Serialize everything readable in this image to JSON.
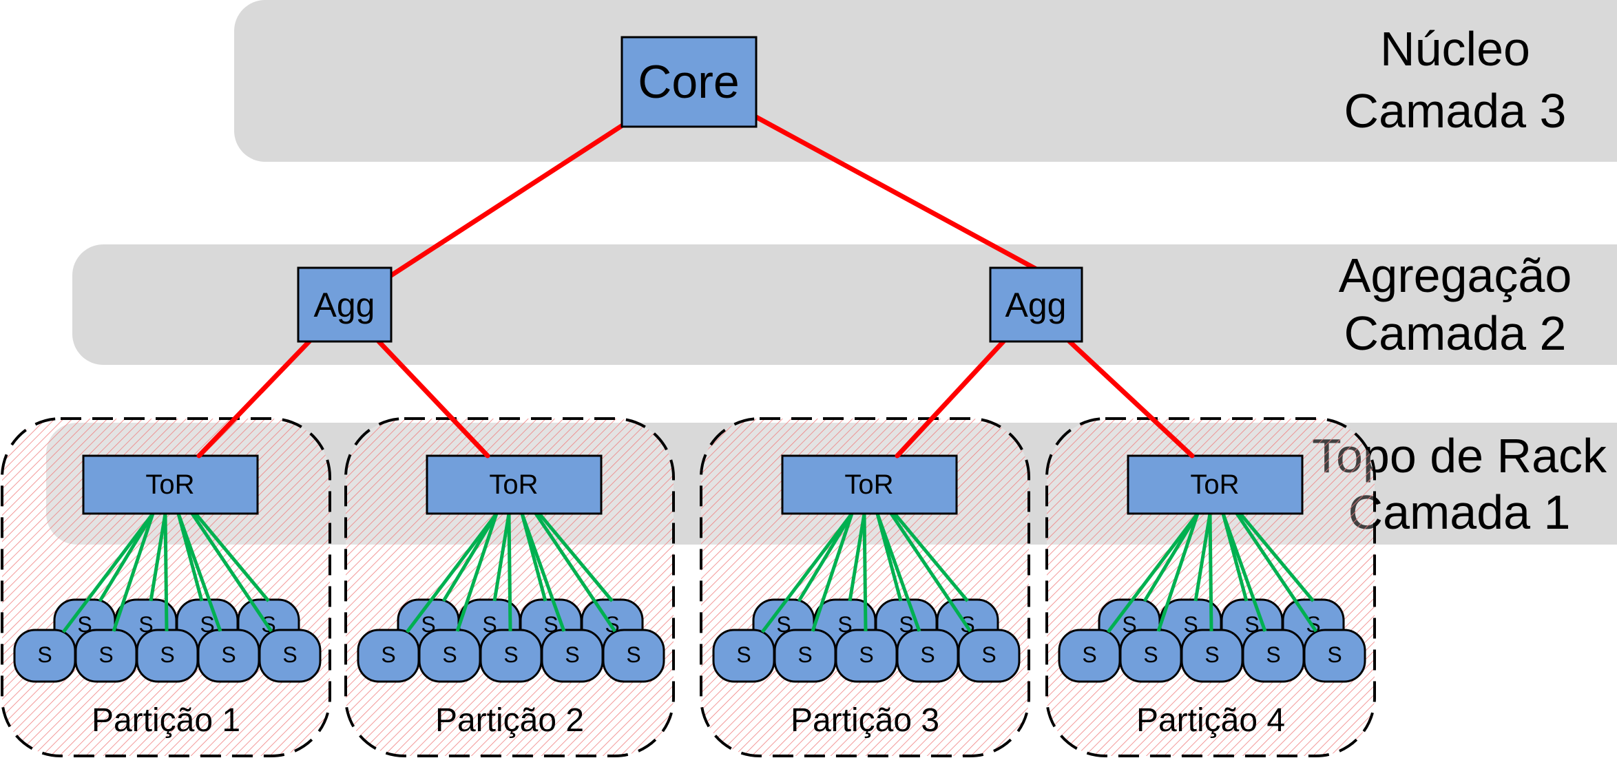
{
  "layers": [
    {
      "line1": "Núcleo",
      "line2": "Camada 3"
    },
    {
      "line1": "Agregação",
      "line2": "Camada 2"
    },
    {
      "line1": "Topo de Rack",
      "line2": "Camada 1"
    }
  ],
  "core": {
    "label": "Core"
  },
  "aggregation": [
    {
      "label": "Agg"
    },
    {
      "label": "Agg"
    }
  ],
  "partitions": [
    {
      "label": "Partição 1",
      "tor": "ToR",
      "server_label": "S",
      "servers": 9
    },
    {
      "label": "Partição 2",
      "tor": "ToR",
      "server_label": "S",
      "servers": 9
    },
    {
      "label": "Partição 3",
      "tor": "ToR",
      "server_label": "S",
      "servers": 9
    },
    {
      "label": "Partição 4",
      "tor": "ToR",
      "server_label": "S",
      "servers": 9
    }
  ],
  "colors": {
    "node": "#729fdb",
    "band": "#d9d9d9",
    "uplink": "#ff0000",
    "server_link": "#00b050",
    "partition_hatch": "#f08080"
  }
}
